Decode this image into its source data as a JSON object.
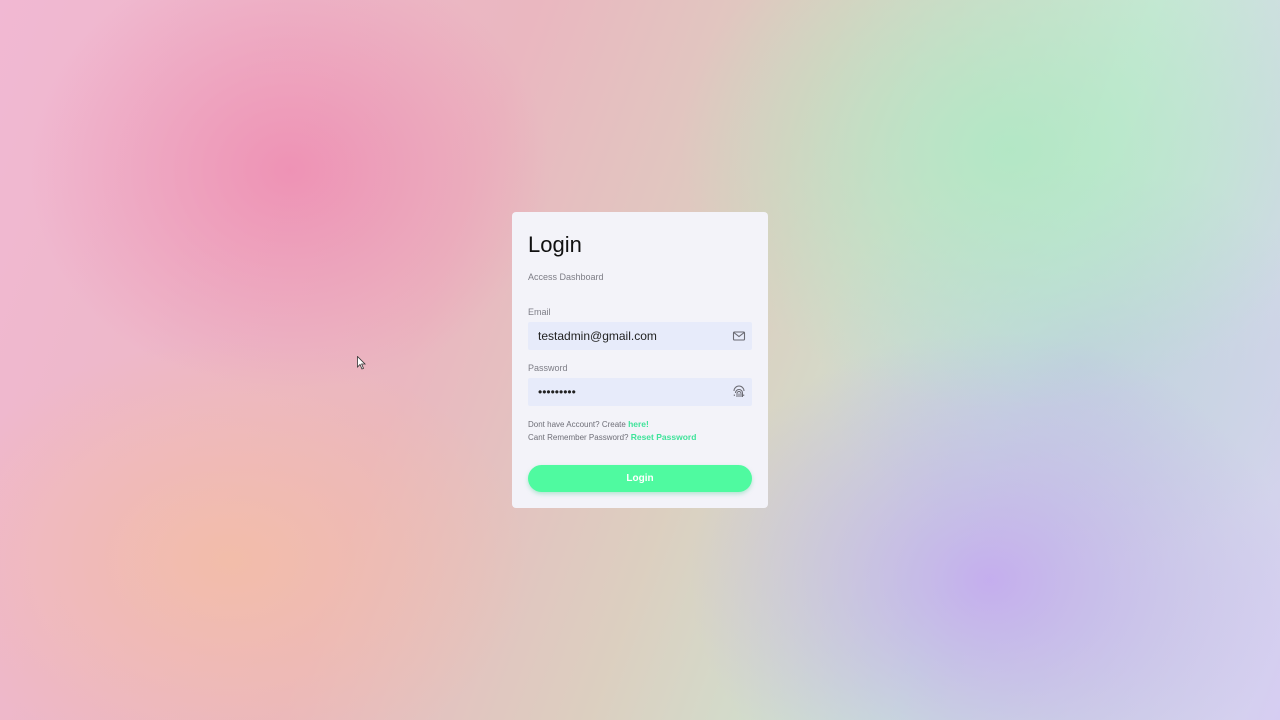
{
  "login_card": {
    "title": "Login",
    "subtitle": "Access Dashboard",
    "email_label": "Email",
    "email_value": "testadmin@gmail.com",
    "email_icon": "mail-icon",
    "password_label": "Password",
    "password_value": "•••••••••",
    "password_icon": "fingerprint-icon",
    "no_account_text": "Dont have Account? Create",
    "create_link": "here!",
    "forgot_text": "Cant Remember Password?",
    "reset_link": "Reset Password",
    "login_button": "Login"
  },
  "colors": {
    "accent": "#4ffaa0",
    "link": "#3fe39a",
    "card_bg": "#f3f3f9",
    "field_bg": "#e7ebfa"
  }
}
